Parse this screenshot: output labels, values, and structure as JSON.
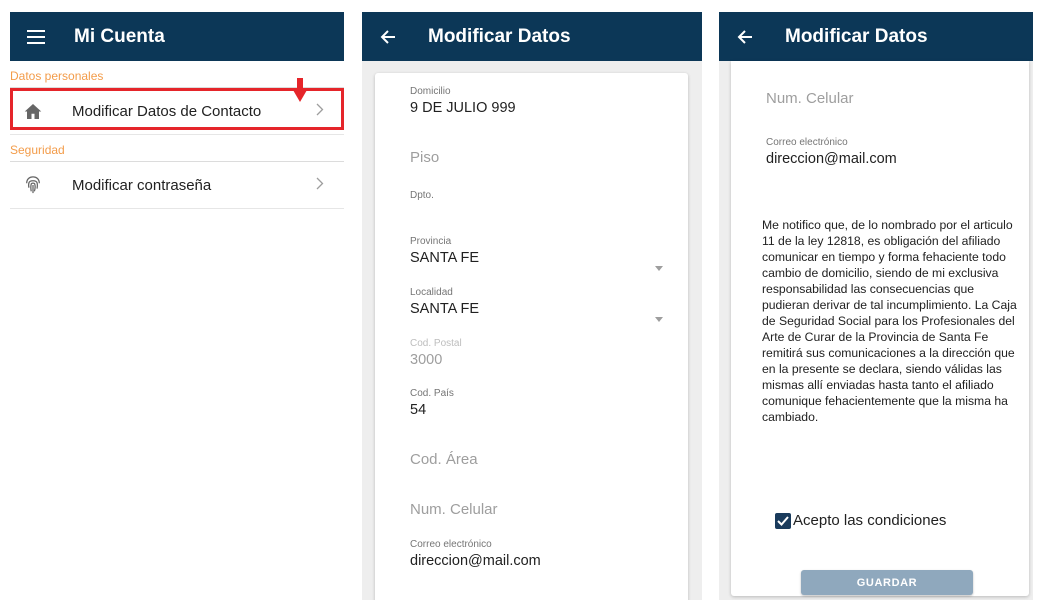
{
  "screen1": {
    "title": "Mi Cuenta",
    "sections": [
      {
        "header": "Datos personales",
        "items": [
          {
            "label": "Modificar Datos de Contacto",
            "icon": "home-icon"
          }
        ]
      },
      {
        "header": "Seguridad",
        "items": [
          {
            "label": "Modificar contraseña",
            "icon": "fingerprint-icon"
          }
        ]
      }
    ]
  },
  "screen2": {
    "title": "Modificar Datos",
    "fields": {
      "domicilio": {
        "label": "Domicilio",
        "value": "9 DE JULIO 999"
      },
      "piso": {
        "placeholder": "Piso"
      },
      "dpto": {
        "label": "Dpto.",
        "value": ""
      },
      "provincia": {
        "label": "Provincia",
        "value": "SANTA FE"
      },
      "localidad": {
        "label": "Localidad",
        "value": "SANTA FE"
      },
      "cod_postal": {
        "label": "Cod. Postal",
        "value": "3000"
      },
      "cod_pais": {
        "label": "Cod. País",
        "value": "54"
      },
      "cod_area": {
        "placeholder": "Cod. Área"
      },
      "num_celular": {
        "placeholder": "Num. Celular"
      },
      "correo": {
        "label": "Correo electrónico",
        "value": "direccion@mail.com"
      }
    }
  },
  "screen3": {
    "title": "Modificar Datos",
    "num_celular_placeholder": "Num. Celular",
    "correo": {
      "label": "Correo electrónico",
      "value": "direccion@mail.com"
    },
    "notice": "Me notifico que, de lo nombrado por el articulo 11 de la ley 12818, es obligación del afiliado comunicar en tiempo y forma fehaciente todo cambio de domicilio, siendo de mi exclusiva responsabilidad las consecuencias que pudieran derivar de tal incumplimiento. La Caja de Seguridad Social para los Profesionales del Arte de Curar de la Provincia de Santa Fe remitirá sus comunicaciones a la dirección que en la presente se declara, siendo válidas las mismas allí enviadas hasta tanto el afiliado comunique fehacientemente que la misma ha cambiado.",
    "accept_label": "Acepto las condiciones",
    "accept_checked": true,
    "save_label": "GUARDAR"
  },
  "colors": {
    "appbar": "#0c3757",
    "section_header": "#f39c4a",
    "highlight": "#e5252a",
    "button": "#8fa8bd"
  }
}
